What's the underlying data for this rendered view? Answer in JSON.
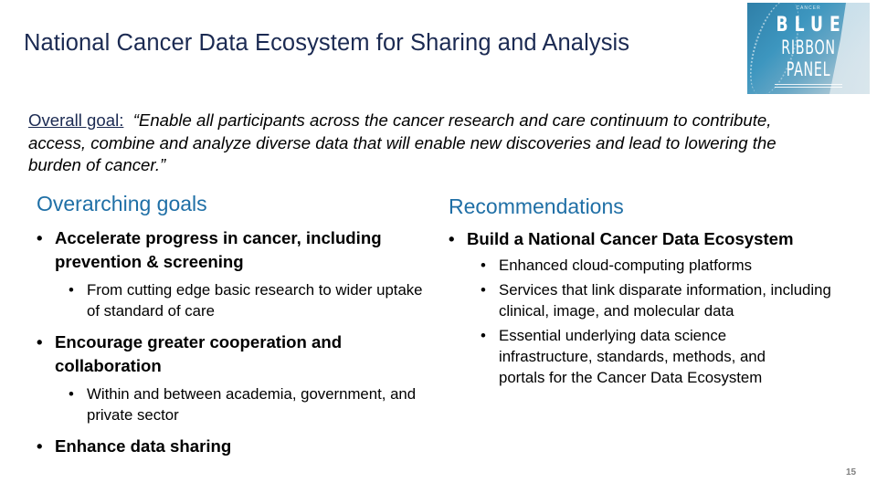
{
  "header": {
    "title": "National Cancer Data Ecosystem for Sharing and Analysis"
  },
  "logo": {
    "small_text": "CANCER",
    "line1": "BLUE",
    "line2": "RIBBON",
    "line3": "PANEL"
  },
  "overall_goal": {
    "label": "Overall goal:",
    "quote": "“Enable all participants across the cancer research and care continuum to contribute, access, combine and analyze diverse data that will enable new discoveries and lead to lowering the burden of cancer.”"
  },
  "left_column": {
    "heading": "Overarching goals",
    "items": [
      {
        "text": "Accelerate progress in cancer, including prevention & screening",
        "subitems": [
          "From cutting edge basic research to wider uptake of standard of care"
        ]
      },
      {
        "text": "Encourage greater cooperation and collaboration",
        "subitems": [
          "Within and between academia, government, and private sector"
        ]
      },
      {
        "text": "Enhance data sharing",
        "subitems": []
      }
    ]
  },
  "right_column": {
    "heading": "Recommendations",
    "items": [
      {
        "text": "Build a National Cancer Data Ecosystem",
        "subitems": [
          "Enhanced cloud-computing platforms",
          "Services that link disparate information, including clinical, image, and molecular data",
          "Essential underlying data science infrastructure, standards, methods, and portals for the Cancer Data Ecosystem"
        ]
      }
    ]
  },
  "footer": {
    "page_number": "15"
  },
  "colors": {
    "title": "#1b2a52",
    "heading": "#1f6fa6",
    "page_number": "#7f7f7f"
  }
}
